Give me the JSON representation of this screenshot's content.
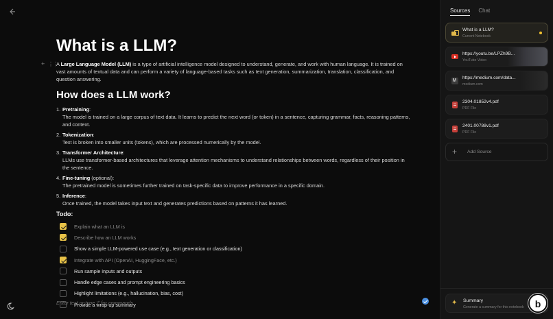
{
  "editor": {
    "title": "What is a LLM?",
    "intro": {
      "prefix": "A ",
      "bold": "Large Language Model (LLM)",
      "rest": " is a type of artificial intelligence model designed to understand, generate, and work with human language. It is trained on vast amounts of textual data and can perform a variety of language-based tasks such as text generation, summarization, translation, classification, and question answering."
    },
    "section_heading": "How does a LLM work?",
    "steps": [
      {
        "number": "1.",
        "title": "Pretraining",
        "suffix": ":",
        "desc": "The model is trained on a large corpus of text data. It learns to predict the next word (or token) in a sentence, capturing grammar, facts, reasoning patterns, and context."
      },
      {
        "number": "2.",
        "title": "Tokenization",
        "suffix": ":",
        "desc": "Text is broken into smaller units (tokens), which are processed numerically by the model."
      },
      {
        "number": "3.",
        "title": "Transformer Architecture",
        "suffix": ":",
        "desc": "LLMs use transformer-based architectures that leverage attention mechanisms to understand relationships between words, regardless of their position in the sentence."
      },
      {
        "number": "4.",
        "title": "Fine-tuning",
        "suffix": " (optional):",
        "desc": "The pretrained model is sometimes further trained on task-specific data to improve performance in a specific domain."
      },
      {
        "number": "5.",
        "title": "Inference",
        "suffix": ":",
        "desc": "Once trained, the model takes input text and generates predictions based on patterns it has learned."
      }
    ],
    "todo_heading": "Todo:",
    "todos": [
      {
        "label": "Explain what an LLM is",
        "checked": true
      },
      {
        "label": "Describe how an LLM works",
        "checked": true
      },
      {
        "label": "Show a simple LLM-powered use case (e.g., text generation or classification)",
        "checked": false
      },
      {
        "label": "Integrate with API (OpenAI, HuggingFace, etc.)",
        "checked": true
      },
      {
        "label": "Run sample inputs and outputs",
        "checked": false
      },
      {
        "label": "Handle edge cases and prompt engineering basics",
        "checked": false
      },
      {
        "label": "Highlight limitations (e.g., hallucination, bias, cost)",
        "checked": false
      },
      {
        "label": "Provide a wrap-up summary",
        "checked": false
      }
    ],
    "placeholder": "Enter text or type '/' for commands"
  },
  "sidebar": {
    "tabs": [
      {
        "label": "Sources",
        "active": true
      },
      {
        "label": "Chat",
        "active": false
      }
    ],
    "sources": [
      {
        "title": "What is a LLM?",
        "subtitle": "Current Notebook",
        "icon": "notebook-icon",
        "active": true
      },
      {
        "title": "https://youtu.be/LPZh9B...",
        "subtitle": "YouTube Video",
        "icon": "youtube-icon",
        "active": false
      },
      {
        "title": "https://medium.com/data...",
        "subtitle": "medium.com",
        "icon": "medium-icon",
        "active": false
      },
      {
        "title": "2304.01852v4.pdf",
        "subtitle": "PDF File",
        "icon": "pdf-icon",
        "active": false
      },
      {
        "title": "2401.00788v1.pdf",
        "subtitle": "PDF File",
        "icon": "pdf-icon",
        "active": false
      }
    ],
    "add_source_label": "Add Source",
    "summary": {
      "title": "Summary",
      "subtitle": "Generate a summary for this notebook",
      "icon": "sparkle-icon"
    }
  },
  "colors": {
    "accent": "#e8c247",
    "background": "#0c0c0c",
    "sidebar": "#151515",
    "send": "#4a8fe0"
  },
  "icons": {
    "back": "arrow-left-icon",
    "theme": "moon-icon",
    "add_block": "plus-icon",
    "drag": "drag-handle-icon",
    "add_source": "plus-icon",
    "badge": "b-logo-icon"
  }
}
